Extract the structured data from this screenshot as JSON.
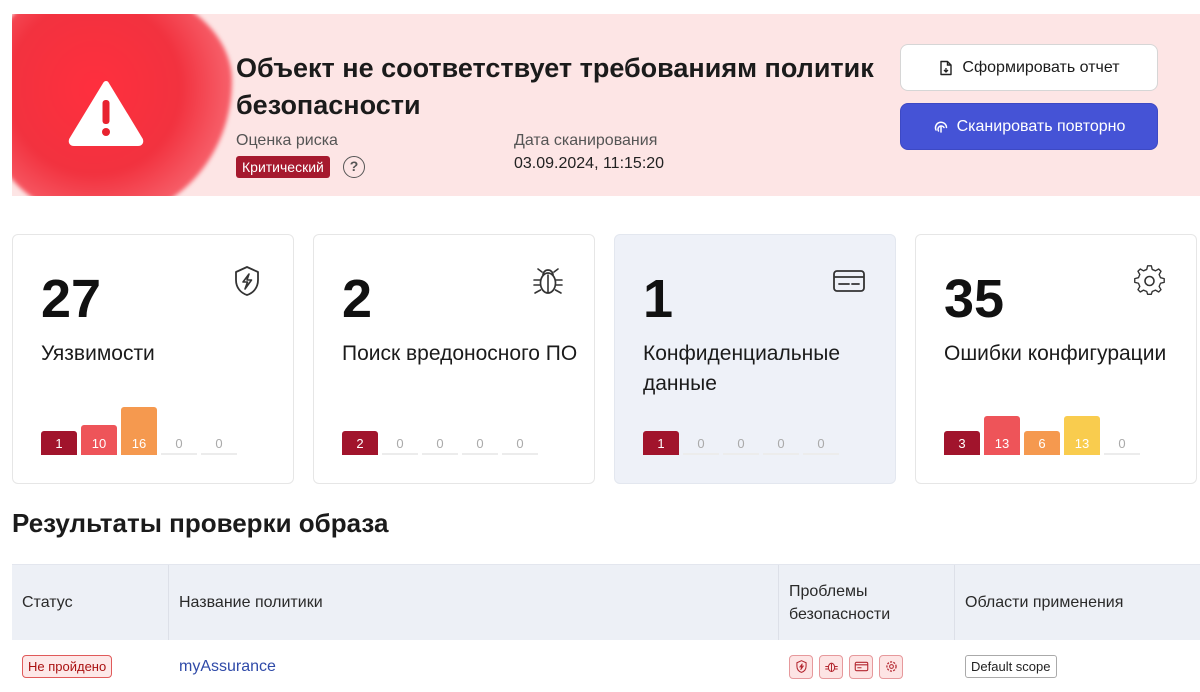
{
  "banner": {
    "title": "Объект не соответствует требованиям политик безопасности",
    "risk_label": "Оценка риска",
    "risk_value": "Критический",
    "help": "?",
    "scan_date_label": "Дата сканирования",
    "scan_date_value": "03.09.2024, 11:15:20",
    "report_button": "Сформировать отчет",
    "rescan_button": "Сканировать повторно",
    "accent_color": "#4553d6",
    "alert_color": "#f2323f"
  },
  "cards": [
    {
      "count": "27",
      "label": "Уязвимости",
      "icon": "shield-bolt-icon",
      "bars": [
        1,
        10,
        16,
        0,
        0
      ]
    },
    {
      "count": "2",
      "label": "Поиск вредоносного ПО",
      "icon": "bug-icon",
      "bars": [
        2,
        0,
        0,
        0,
        0
      ]
    },
    {
      "count": "1",
      "label": "Конфиденциальные данные",
      "icon": "credit-card-icon",
      "bars": [
        1,
        0,
        0,
        0,
        0
      ]
    },
    {
      "count": "35",
      "label": "Ошибки конфигурации",
      "icon": "gear-alert-icon",
      "bars": [
        3,
        13,
        6,
        13,
        0
      ]
    }
  ],
  "severity_colors": [
    "#a1142c",
    "#ee5459",
    "#f5994f",
    "#f9cc4e",
    "#cfd2d8"
  ],
  "section_title": "Результаты проверки образа",
  "table": {
    "headers": [
      "Статус",
      "Название политики",
      "Проблемы безопасности",
      "Области применения"
    ],
    "rows": [
      {
        "status": "Не пройдено",
        "policy": "myAssurance",
        "issues": [
          "shield-bolt-icon",
          "bug-icon",
          "credit-card-icon",
          "gear-alert-icon"
        ],
        "scope": "Default scope"
      }
    ]
  }
}
